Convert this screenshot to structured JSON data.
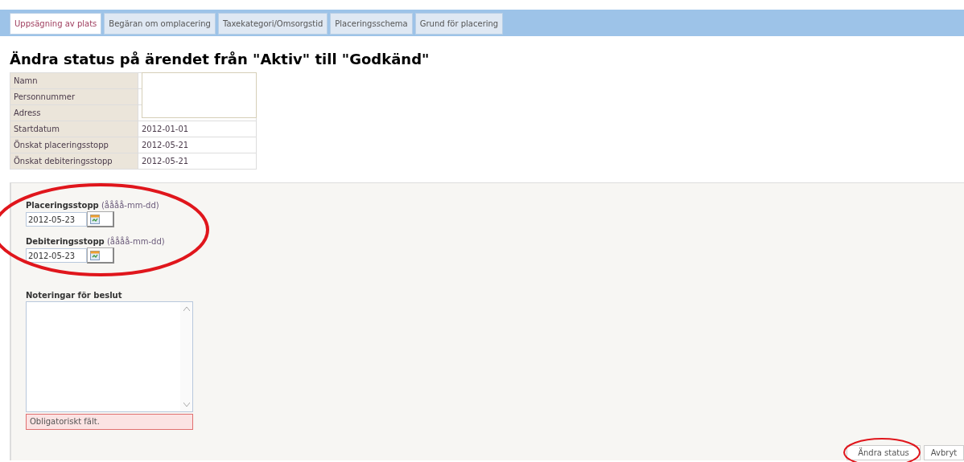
{
  "tabs": [
    {
      "label": "Uppsägning av plats",
      "selected": true
    },
    {
      "label": "Begäran om omplacering",
      "selected": false
    },
    {
      "label": "Taxekategori/Omsorgstid",
      "selected": false
    },
    {
      "label": "Placeringsschema",
      "selected": false
    },
    {
      "label": "Grund för placering",
      "selected": false
    }
  ],
  "title": "Ändra status på ärendet från \"Aktiv\" till \"Godkänd\"",
  "info_rows": [
    {
      "label": "Namn"
    },
    {
      "label": "Personnummer"
    },
    {
      "label": "Adress"
    },
    {
      "label": "Startdatum",
      "value": "2012-01-01"
    },
    {
      "label": "Önskat placeringsstopp",
      "value": "2012-05-21"
    },
    {
      "label": "Önskat debiteringsstopp",
      "value": "2012-05-21"
    }
  ],
  "date_fields": [
    {
      "label": "Placeringsstopp",
      "hint": "(åååå-mm-dd)",
      "value": "2012-05-23"
    },
    {
      "label": "Debiteringsstopp",
      "hint": "(åååå-mm-dd)",
      "value": "2012-05-23"
    }
  ],
  "notes": {
    "label": "Noteringar för beslut",
    "error": "Obligatoriskt fält."
  },
  "buttons": [
    "Ändra status",
    "Avbryt"
  ]
}
